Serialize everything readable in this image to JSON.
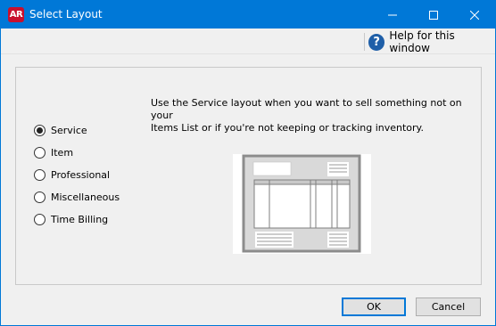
{
  "window": {
    "title": "Select Layout",
    "app_icon_text": "AR",
    "controls": [
      "minimize-icon",
      "maximize-icon",
      "close-icon"
    ]
  },
  "help": {
    "label": "Help for this window",
    "icon_text": "?",
    "icon": "help-icon"
  },
  "layout_options": [
    {
      "label": "Service",
      "selected": true
    },
    {
      "label": "Item",
      "selected": false
    },
    {
      "label": "Professional",
      "selected": false
    },
    {
      "label": "Miscellaneous",
      "selected": false
    },
    {
      "label": "Time Billing",
      "selected": false
    }
  ],
  "description": {
    "line1": "Use the Service layout when you want to sell something not on your",
    "line2": "Items List or if you're not keeping or tracking inventory."
  },
  "buttons": {
    "ok": "OK",
    "cancel": "Cancel"
  },
  "colors": {
    "titlebar": "#0078d7",
    "app_icon": "#c8102e",
    "help_icon": "#1f5fa8",
    "preview_frame": "#8c8c8c",
    "preview_fill": "#d9d9d9"
  }
}
